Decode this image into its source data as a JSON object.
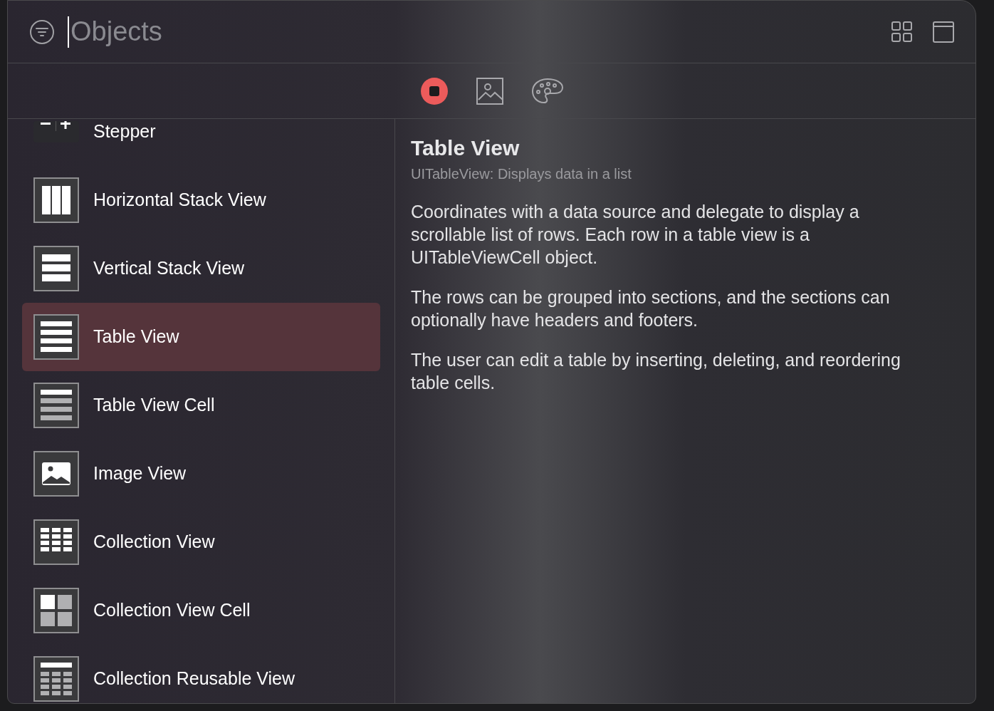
{
  "search": {
    "placeholder": "Objects"
  },
  "library_tabs": [
    {
      "kind": "objects",
      "selected": true
    },
    {
      "kind": "media",
      "selected": false
    },
    {
      "kind": "colors",
      "selected": false
    }
  ],
  "objects": [
    {
      "kind": "stepper",
      "label": "Stepper",
      "selected": false
    },
    {
      "kind": "hstack",
      "label": "Horizontal Stack View",
      "selected": false
    },
    {
      "kind": "vstack",
      "label": "Vertical Stack View",
      "selected": false
    },
    {
      "kind": "table",
      "label": "Table View",
      "selected": true
    },
    {
      "kind": "tablecell",
      "label": "Table View Cell",
      "selected": false
    },
    {
      "kind": "image",
      "label": "Image View",
      "selected": false
    },
    {
      "kind": "collection",
      "label": "Collection View",
      "selected": false
    },
    {
      "kind": "collectioncell",
      "label": "Collection View Cell",
      "selected": false
    },
    {
      "kind": "reusable",
      "label": "Collection Reusable View",
      "selected": false
    }
  ],
  "detail": {
    "title": "Table View",
    "subtitle": "UITableView: Displays data in a list",
    "paragraphs": [
      "Coordinates with a data source and delegate to display a scrollable list of rows. Each row in a table view is a UITableViewCell object.",
      "The rows can be grouped into sections, and the sections can optionally have headers and footers.",
      "The user can edit a table by inserting, deleting, and reordering table cells."
    ]
  }
}
